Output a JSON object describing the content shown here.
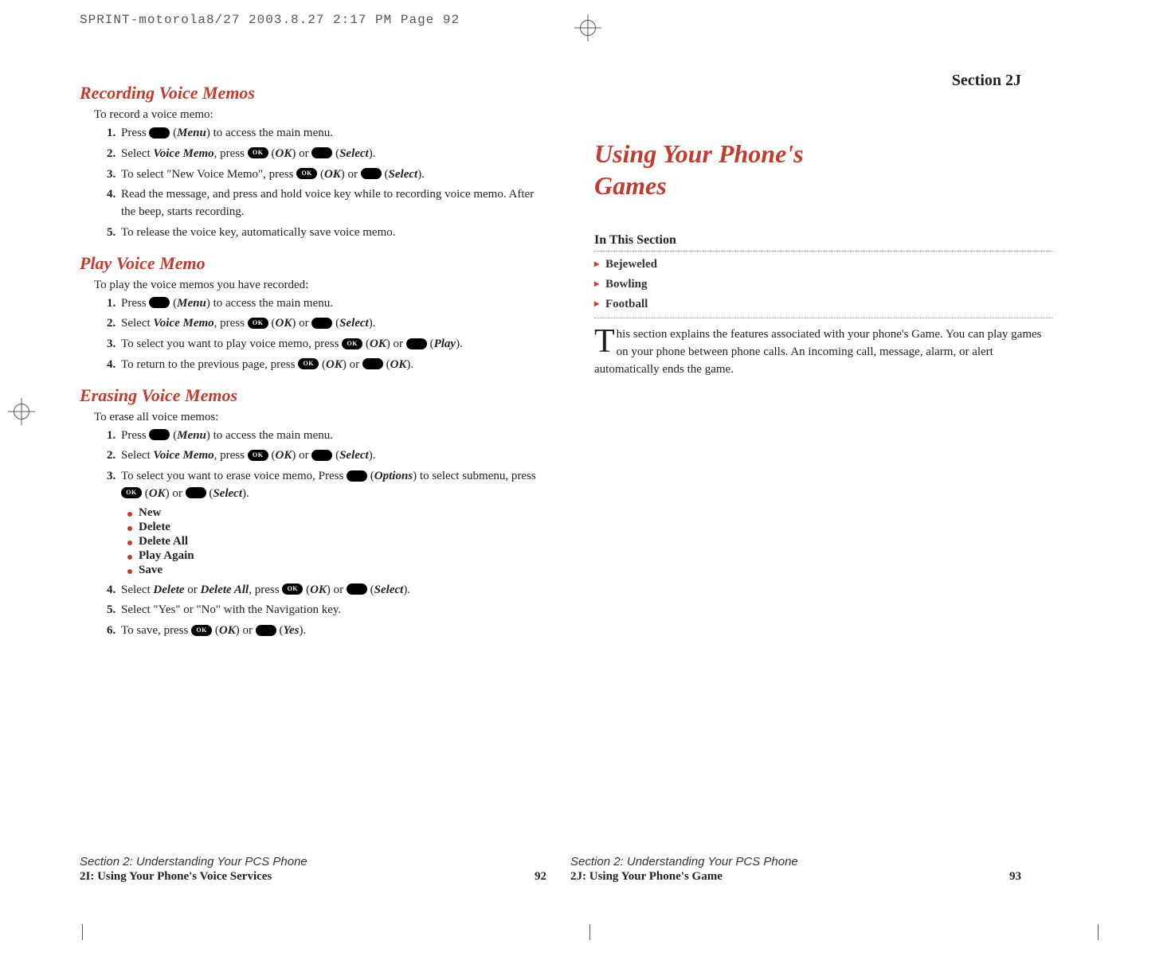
{
  "slug": "SPRINT-motorola8/27  2003.8.27  2:17 PM  Page 92",
  "left": {
    "h_record": "Recording Voice Memos",
    "intro_record": "To record a voice memo:",
    "rec": {
      "s1a": "Press ",
      "s1b": " (",
      "s1c": "Menu",
      "s1d": ") to access the main menu.",
      "s2a": "Select ",
      "s2b": "Voice Memo",
      "s2c": ", press ",
      "s2d": " (",
      "s2e": "OK",
      "s2f": ") or ",
      "s2g": " (",
      "s2h": "Select",
      "s2i": ").",
      "s3a": "To select \"New Voice Memo\", press ",
      "s3b": " (",
      "s3c": "OK",
      "s3d": ") or ",
      "s3e": " (",
      "s3f": "Select",
      "s3g": ").",
      "s4": "Read the message, and press and hold voice key while to recording voice memo. After the beep, starts recording.",
      "s5": "To release the voice key, automatically save voice memo."
    },
    "h_play": "Play Voice Memo",
    "intro_play": "To play the voice memos you have recorded:",
    "play": {
      "s1a": "Press ",
      "s1b": " (",
      "s1c": "Menu",
      "s1d": ") to access the main menu.",
      "s2a": "Select ",
      "s2b": "Voice Memo",
      "s2c": ", press ",
      "s2d": " (",
      "s2e": "OK",
      "s2f": ") or ",
      "s2g": " (",
      "s2h": "Select",
      "s2i": ").",
      "s3a": "To select you want to play voice memo, press ",
      "s3b": " (",
      "s3c": "OK",
      "s3d": ") or ",
      "s3e": " (",
      "s3f": "Play",
      "s3g": ").",
      "s4a": "To return to the previous page, press ",
      "s4b": " (",
      "s4c": "OK",
      "s4d": ") or ",
      "s4e": " (",
      "s4f": "OK",
      "s4g": ")."
    },
    "h_erase": "Erasing Voice Memos",
    "intro_erase": "To erase all voice memos:",
    "erase": {
      "s1a": "Press ",
      "s1b": " (",
      "s1c": "Menu",
      "s1d": ") to access the main menu.",
      "s2a": "Select ",
      "s2b": "Voice Memo",
      "s2c": ", press ",
      "s2d": " (",
      "s2e": "OK",
      "s2f": ") or ",
      "s2g": " (",
      "s2h": "Select",
      "s2i": ").",
      "s3a": "To select you want to erase voice memo, Press ",
      "s3b": " (",
      "s3c": "Options",
      "s3d": ") to select submenu, press ",
      "s3e": " (",
      "s3f": "OK",
      "s3g": ") or ",
      "s3h": " (",
      "s3i": "Select",
      "s3j": ").",
      "sub1": "New",
      "sub2": "Delete",
      "sub3": "Delete All",
      "sub4": "Play Again",
      "sub5": "Save",
      "s4a": "Select ",
      "s4b": "Delete",
      "s4c": " or ",
      "s4d": "Delete All",
      "s4e": ", press ",
      "s4f": " (",
      "s4g": "OK",
      "s4h": ") or ",
      "s4i": " (",
      "s4j": "Select",
      "s4k": ").",
      "s5": "Select \"Yes\" or \"No\" with the Navigation key.",
      "s6a": "To save, press ",
      "s6b": " (",
      "s6c": "OK",
      "s6d": ") or ",
      "s6e": " (",
      "s6f": "Yes",
      "s6g": ")."
    },
    "footer1": "Section 2: Understanding Your PCS Phone",
    "footer2": "2I: Using Your Phone's Voice Services",
    "page": "92"
  },
  "right": {
    "section_label": "Section 2J",
    "title_l1": "Using Your Phone's",
    "title_l2": "Games",
    "in_this": "In This Section",
    "toc1": "Bejeweled",
    "toc2": "Bowling",
    "toc3": "Football",
    "para": "his section explains the features associated with your phone's Game. You can play games on your phone between phone calls. An incoming call, message, alarm, or alert automatically ends the game.",
    "dropcap": "T",
    "footer1": "Section 2: Understanding Your PCS Phone",
    "footer2": "2J: Using Your Phone's Game",
    "page": "93"
  },
  "nums": {
    "n1": "1.",
    "n2": "2.",
    "n3": "3.",
    "n4": "4.",
    "n5": "5.",
    "n6": "6."
  }
}
